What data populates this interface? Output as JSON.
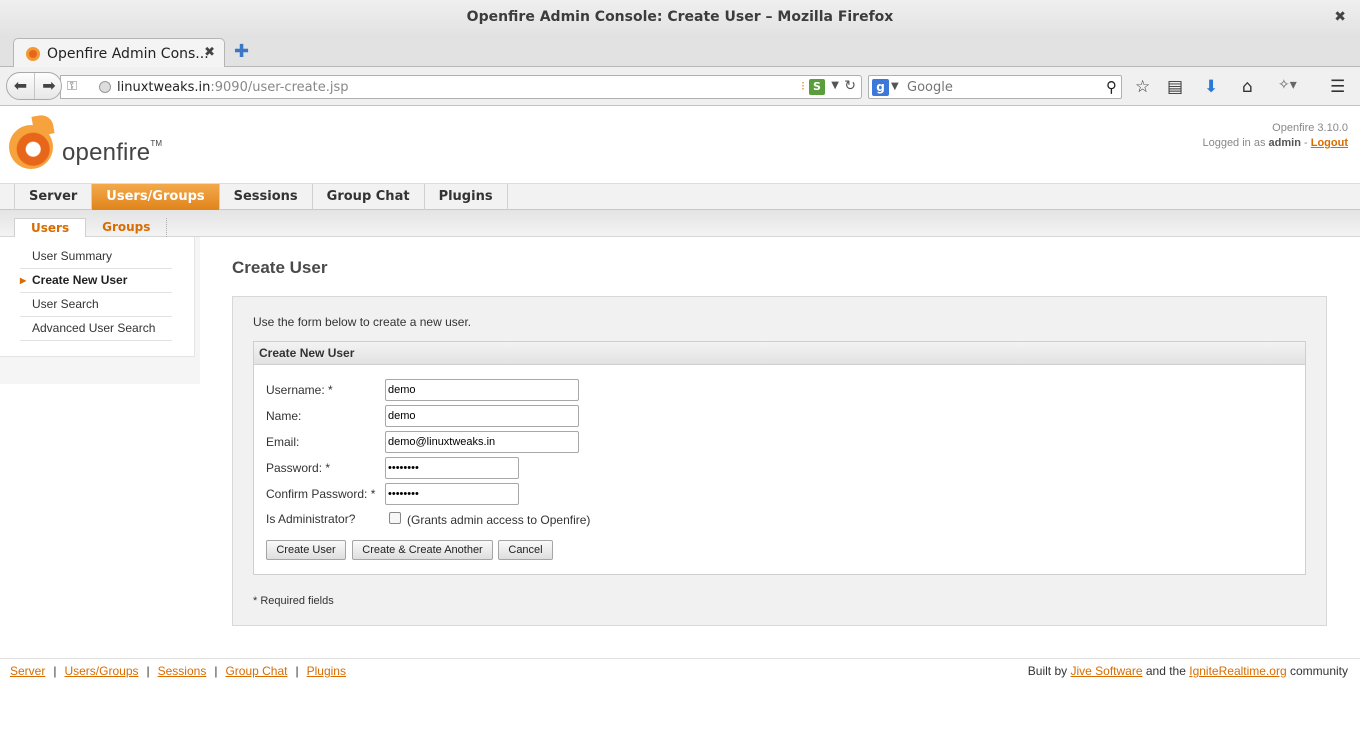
{
  "window": {
    "title": "Openfire Admin Console: Create User – Mozilla Firefox",
    "close_glyph": "✖"
  },
  "browser": {
    "tab_title": "Openfire Admin Cons...",
    "tab_close": "✖",
    "new_tab": "✚",
    "url_host": "linuxtweaks.in",
    "url_rest": ":9090/user-create.jsp",
    "search_placeholder": "Google"
  },
  "header": {
    "logo_text": "openfire",
    "logo_tm": "TM",
    "version": "Openfire 3.10.0",
    "logged_in_prefix": "Logged in as",
    "user": "admin",
    "logged_sep": "-",
    "logout": "Logout"
  },
  "main_nav": [
    {
      "label": "Server",
      "active": false
    },
    {
      "label": "Users/Groups",
      "active": true
    },
    {
      "label": "Sessions",
      "active": false
    },
    {
      "label": "Group Chat",
      "active": false
    },
    {
      "label": "Plugins",
      "active": false
    }
  ],
  "sub_nav": [
    {
      "label": "Users",
      "active": true
    },
    {
      "label": "Groups",
      "active": false
    }
  ],
  "sidebar": {
    "items": [
      {
        "label": "User Summary",
        "active": false
      },
      {
        "label": "Create New User",
        "active": true
      },
      {
        "label": "User Search",
        "active": false
      },
      {
        "label": "Advanced User Search",
        "active": false
      }
    ]
  },
  "page": {
    "title": "Create User",
    "intro": "Use the form below to create a new user.",
    "form_header": "Create New User",
    "fields": {
      "username_label": "Username: *",
      "username_value": "demo",
      "name_label": "Name:",
      "name_value": "demo",
      "email_label": "Email:",
      "email_value": "demo@linuxtweaks.in",
      "password_label": "Password: *",
      "password_value": "********",
      "confirm_label": "Confirm Password: *",
      "confirm_value": "********",
      "admin_label": "Is Administrator?",
      "admin_note": "(Grants admin access to Openfire)",
      "admin_checked": false
    },
    "buttons": {
      "create": "Create User",
      "create_another": "Create & Create Another",
      "cancel": "Cancel"
    },
    "required_note": "* Required fields"
  },
  "footer": {
    "links": [
      "Server",
      "Users/Groups",
      "Sessions",
      "Group Chat",
      "Plugins"
    ],
    "separator": "|",
    "built_by": "Built by",
    "jive": "Jive Software",
    "and_the": "and the",
    "ignite": "IgniteRealtime.org",
    "community": "community"
  },
  "colors": {
    "accent": "#d86c00",
    "active_tab": "#e0841c"
  }
}
